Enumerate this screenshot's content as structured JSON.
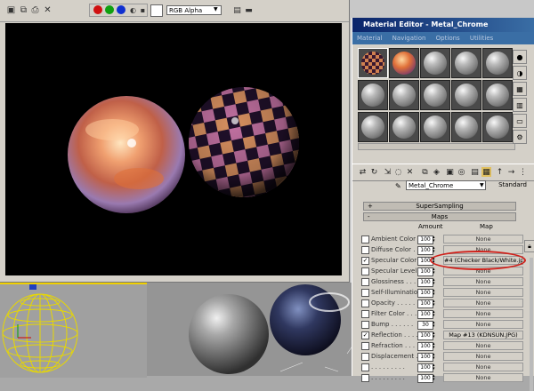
{
  "render_window": {
    "toolbar": {
      "channel_select": "RGB Alpha",
      "swatch_colors": [
        "#d01010",
        "#10a010",
        "#1030d0"
      ]
    }
  },
  "material_editor": {
    "title": "Material Editor - Metal_Chrome",
    "menu": [
      "Material",
      "Navigation",
      "Options",
      "Utilities"
    ],
    "material_name": "Metal_Chrome",
    "material_type": "Standard",
    "rollouts": {
      "supersampling": {
        "sign": "+",
        "label": "SuperSampling"
      },
      "maps": {
        "sign": "-",
        "label": "Maps"
      }
    },
    "maps_header": {
      "amount": "Amount",
      "map": "Map"
    },
    "map_rows": [
      {
        "checked": false,
        "label": "Ambient Color . .",
        "amount": "100",
        "map": "None"
      },
      {
        "checked": false,
        "label": "Diffuse Color . .",
        "amount": "100",
        "map": "None"
      },
      {
        "checked": true,
        "label": "Specular Color . .",
        "amount": "100",
        "map": "#4 (Checker Black/White.jpg)"
      },
      {
        "checked": false,
        "label": "Specular Level . .",
        "amount": "100",
        "map": "None"
      },
      {
        "checked": false,
        "label": "Glossiness . . . .",
        "amount": "100",
        "map": "None"
      },
      {
        "checked": false,
        "label": "Self-Illumination .",
        "amount": "100",
        "map": "None"
      },
      {
        "checked": false,
        "label": "Opacity . . . . .",
        "amount": "100",
        "map": "None"
      },
      {
        "checked": false,
        "label": "Filter Color . . .",
        "amount": "100",
        "map": "None"
      },
      {
        "checked": false,
        "label": "Bump . . . . . .",
        "amount": "30",
        "map": "None"
      },
      {
        "checked": true,
        "label": "Reflection . . . .",
        "amount": "100",
        "map": "Map #13 (KDNSUN.JPG)"
      },
      {
        "checked": false,
        "label": "Refraction . . . .",
        "amount": "100",
        "map": "None"
      },
      {
        "checked": false,
        "label": "Displacement . . .",
        "amount": "100",
        "map": "None"
      },
      {
        "checked": false,
        "label": ". . . . . . . . .",
        "amount": "100",
        "map": "None"
      },
      {
        "checked": false,
        "label": ". . . . . . . . .",
        "amount": "100",
        "map": "None"
      }
    ]
  },
  "annotation_color": "#d0201a"
}
